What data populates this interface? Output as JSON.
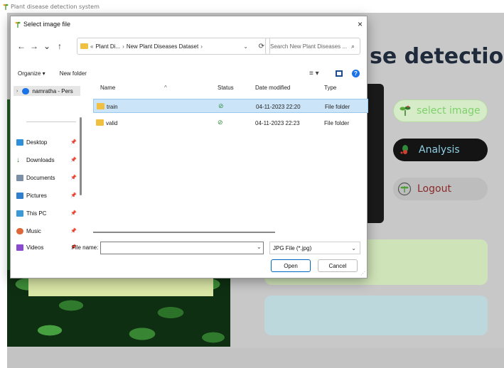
{
  "app": {
    "window_title": "Plant disease detection system",
    "heading": "se detection",
    "buttons": {
      "select_image": "select image",
      "analysis": "Analysis",
      "logout": "Logout"
    }
  },
  "dialog": {
    "title": "Select image file",
    "close": "×",
    "nav": {
      "back": "←",
      "forward": "→",
      "recent": "⌄",
      "up": "↑"
    },
    "address": {
      "prefix": "«",
      "parts": [
        "Plant Di...",
        "New Plant Diseases Dataset"
      ],
      "separator": "›",
      "dropdown": "⌄",
      "refresh": "⟳"
    },
    "search": {
      "placeholder": "Search New Plant Diseases ...",
      "icon": "⌕"
    },
    "toolbar": {
      "organize": "Organize ▾",
      "new_folder": "New folder",
      "view": "≡ ▾",
      "help": "?"
    },
    "sidebar": {
      "top_item": "namratha - Pers",
      "items": [
        {
          "label": "Desktop",
          "icon": "desktop-icon",
          "color": "#2f8fd8"
        },
        {
          "label": "Downloads",
          "icon": "download-icon",
          "color": "#2b7a3a"
        },
        {
          "label": "Documents",
          "icon": "document-icon",
          "color": "#7a8fa6"
        },
        {
          "label": "Pictures",
          "icon": "pictures-icon",
          "color": "#2f7fd0"
        },
        {
          "label": "This PC",
          "icon": "computer-icon",
          "color": "#3a9ad8"
        },
        {
          "label": "Music",
          "icon": "music-icon",
          "color": "#e0663a"
        },
        {
          "label": "Videos",
          "icon": "video-icon",
          "color": "#8a4ad0"
        }
      ],
      "pin": "📌"
    },
    "columns": {
      "name": "Name",
      "status": "Status",
      "date": "Date modified",
      "type": "Type",
      "sort": "^"
    },
    "rows": [
      {
        "name": "train",
        "status": "⊘",
        "date": "04-11-2023 22:20",
        "type": "File folder",
        "selected": true
      },
      {
        "name": "valid",
        "status": "⊘",
        "date": "04-11-2023 22:23",
        "type": "File folder",
        "selected": false
      }
    ],
    "footer": {
      "file_name_label": "File name:",
      "file_name_value": "",
      "file_type": "JPG File (*.jpg)",
      "dropdown": "⌄",
      "open": "Open",
      "cancel": "Cancel"
    }
  }
}
